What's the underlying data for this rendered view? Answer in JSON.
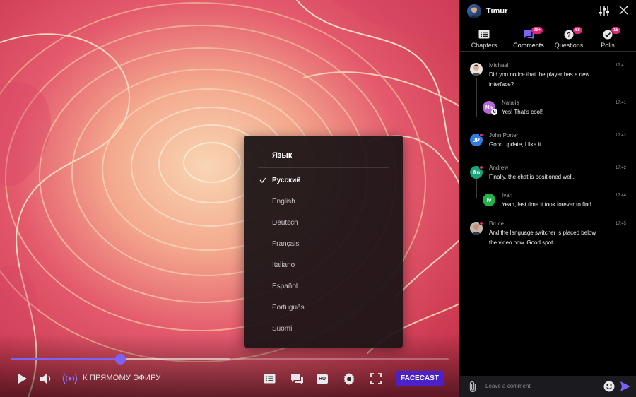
{
  "video": {
    "progress_played": 0.25,
    "progress_buffered": 0.5,
    "live_label": "К ПРЯМОМУ ЭФИРУ",
    "brand_button": "FACECAST",
    "subtitle_lang_badge": "RU",
    "accent_color": "#7b63f3",
    "brand_color": "#4b22c9"
  },
  "language_menu": {
    "title": "Язык",
    "options": [
      "Русский",
      "English",
      "Deutsch",
      "Français",
      "Italiano",
      "Español",
      "Português",
      "Suomi"
    ],
    "selected": "Русский"
  },
  "panel": {
    "user_name": "Timur",
    "tabs": [
      {
        "label": "Chapters",
        "icon": "list-icon",
        "badge": ""
      },
      {
        "label": "Comments",
        "icon": "comments-icon",
        "badge": "99+"
      },
      {
        "label": "Questions",
        "icon": "question-icon",
        "badge": "68"
      },
      {
        "label": "Polls",
        "icon": "check-icon",
        "badge": "15"
      }
    ],
    "active_tab": "Comments",
    "messages": [
      {
        "author": "Michael",
        "text1": "Did you notice that the player has a new",
        "text2": "interface?",
        "time": "17:41",
        "avatar": "photo"
      },
      {
        "author": "Natalia",
        "text1": "Yes! That's cool!",
        "text2": "",
        "time": "17:41",
        "initials": "Na",
        "color": "#b569d6",
        "reply": true,
        "moderator": "M"
      },
      {
        "author": "John Porter",
        "text1": "Good update, I like it.",
        "text2": "",
        "time": "17:42",
        "initials": "JP",
        "color": "#2f7de1"
      },
      {
        "author": "Andrew",
        "text1": "Finally, the chat is positioned well.",
        "text2": "",
        "time": "17:42",
        "initials": "An",
        "color": "#1aa57a"
      },
      {
        "author": "Ivan",
        "text1": "Yeah, last time it took forever to find.",
        "text2": "",
        "time": "17:44",
        "initials": "Iv",
        "color": "#22b14c",
        "reply": true
      },
      {
        "author": "Bruce",
        "text1": "And the language switcher is placed below",
        "text2": "the video now. Good spot.",
        "time": "17:45",
        "avatar": "photo"
      }
    ],
    "composer_placeholder": "Leave a comment",
    "badge_color": "#e52679",
    "send_color": "#7b63f3"
  }
}
